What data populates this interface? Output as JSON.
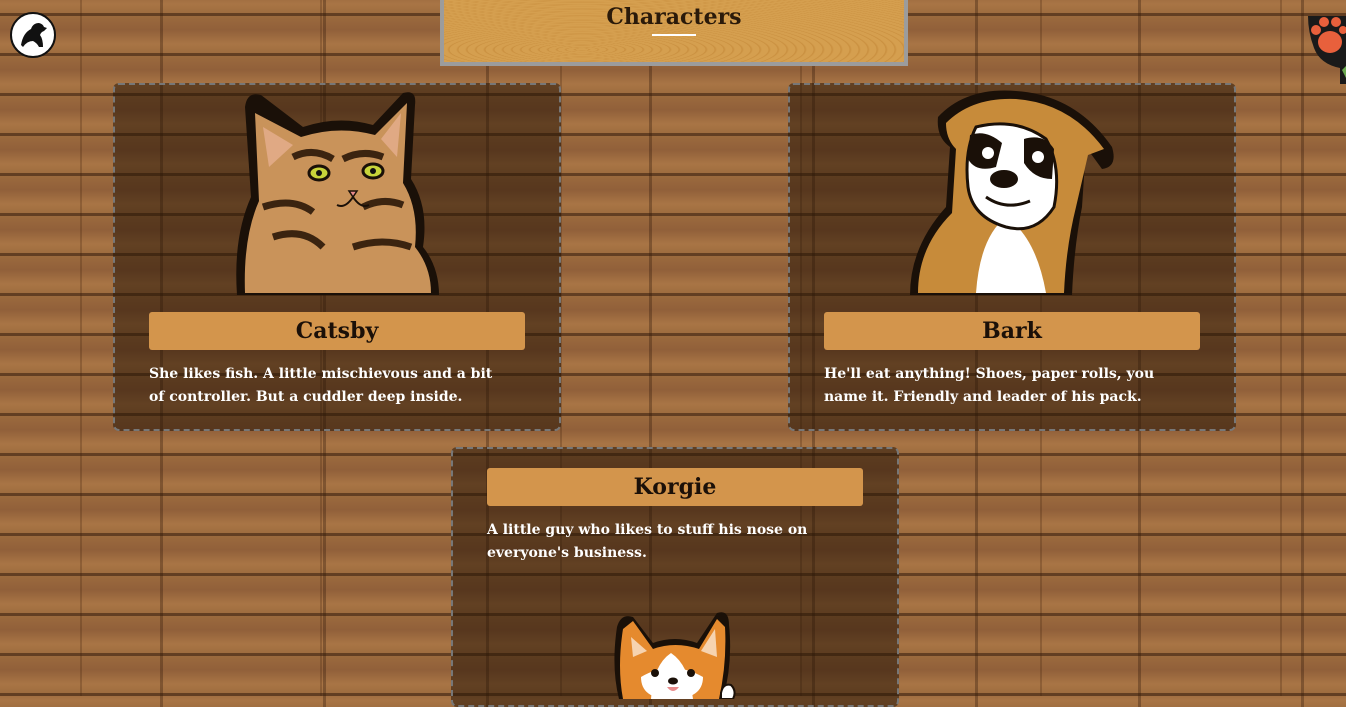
{
  "header": {
    "title": "Characters",
    "logo_icon": "dog-silhouette-icon",
    "corner_icon": "cat-paw-icon"
  },
  "characters": [
    {
      "name": "Catsby",
      "description": "She likes fish. A little mischievous and a bit of controller. But a cuddler deep inside.",
      "image_icon": "tabby-cat-portrait"
    },
    {
      "name": "Bark",
      "description": "He'll eat anything! Shoes, paper rolls, you name it. Friendly and leader of his pack.",
      "image_icon": "boxer-dog-portrait"
    },
    {
      "name": "Korgie",
      "description": "A little guy who likes to stuff his nose on everyone's business.",
      "image_icon": "corgi-portrait"
    }
  ],
  "colors": {
    "name_bar": "#d3954c",
    "card_bg": "rgba(40,22,8,0.55)",
    "title_board": "#d59f4f"
  }
}
